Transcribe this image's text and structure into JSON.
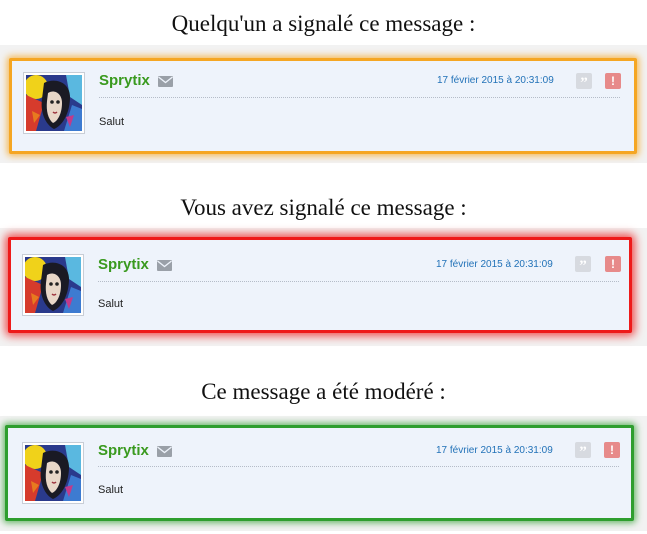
{
  "headings": [
    "Quelqu'un a signalé ce message :",
    "Vous avez signalé ce message :",
    "Ce message a été modéré :"
  ],
  "posts": [
    {
      "state": "signalé par quelqu'un",
      "border_color": "#f5a623",
      "author": "Sprytix",
      "date": "17 février 2015 à 20:31:09",
      "body": "Salut",
      "quote_glyph": "”",
      "report_glyph": "!"
    },
    {
      "state": "signalé par vous",
      "border_color": "#ee1a1a",
      "author": "Sprytix",
      "date": "17 février 2015 à 20:31:09",
      "body": "Salut",
      "quote_glyph": "”",
      "report_glyph": "!"
    },
    {
      "state": "modéré",
      "border_color": "#2e9e2e",
      "author": "Sprytix",
      "date": "17 février 2015 à 20:31:09",
      "body": "Salut",
      "quote_glyph": "”",
      "report_glyph": "!"
    }
  ],
  "colors": {
    "author": "#3a9a1f",
    "date": "#2272b8",
    "post_background": "#eef3fb"
  },
  "icons": {
    "mail": "envelope-icon",
    "quote": "quote-icon",
    "report": "alert-icon"
  }
}
